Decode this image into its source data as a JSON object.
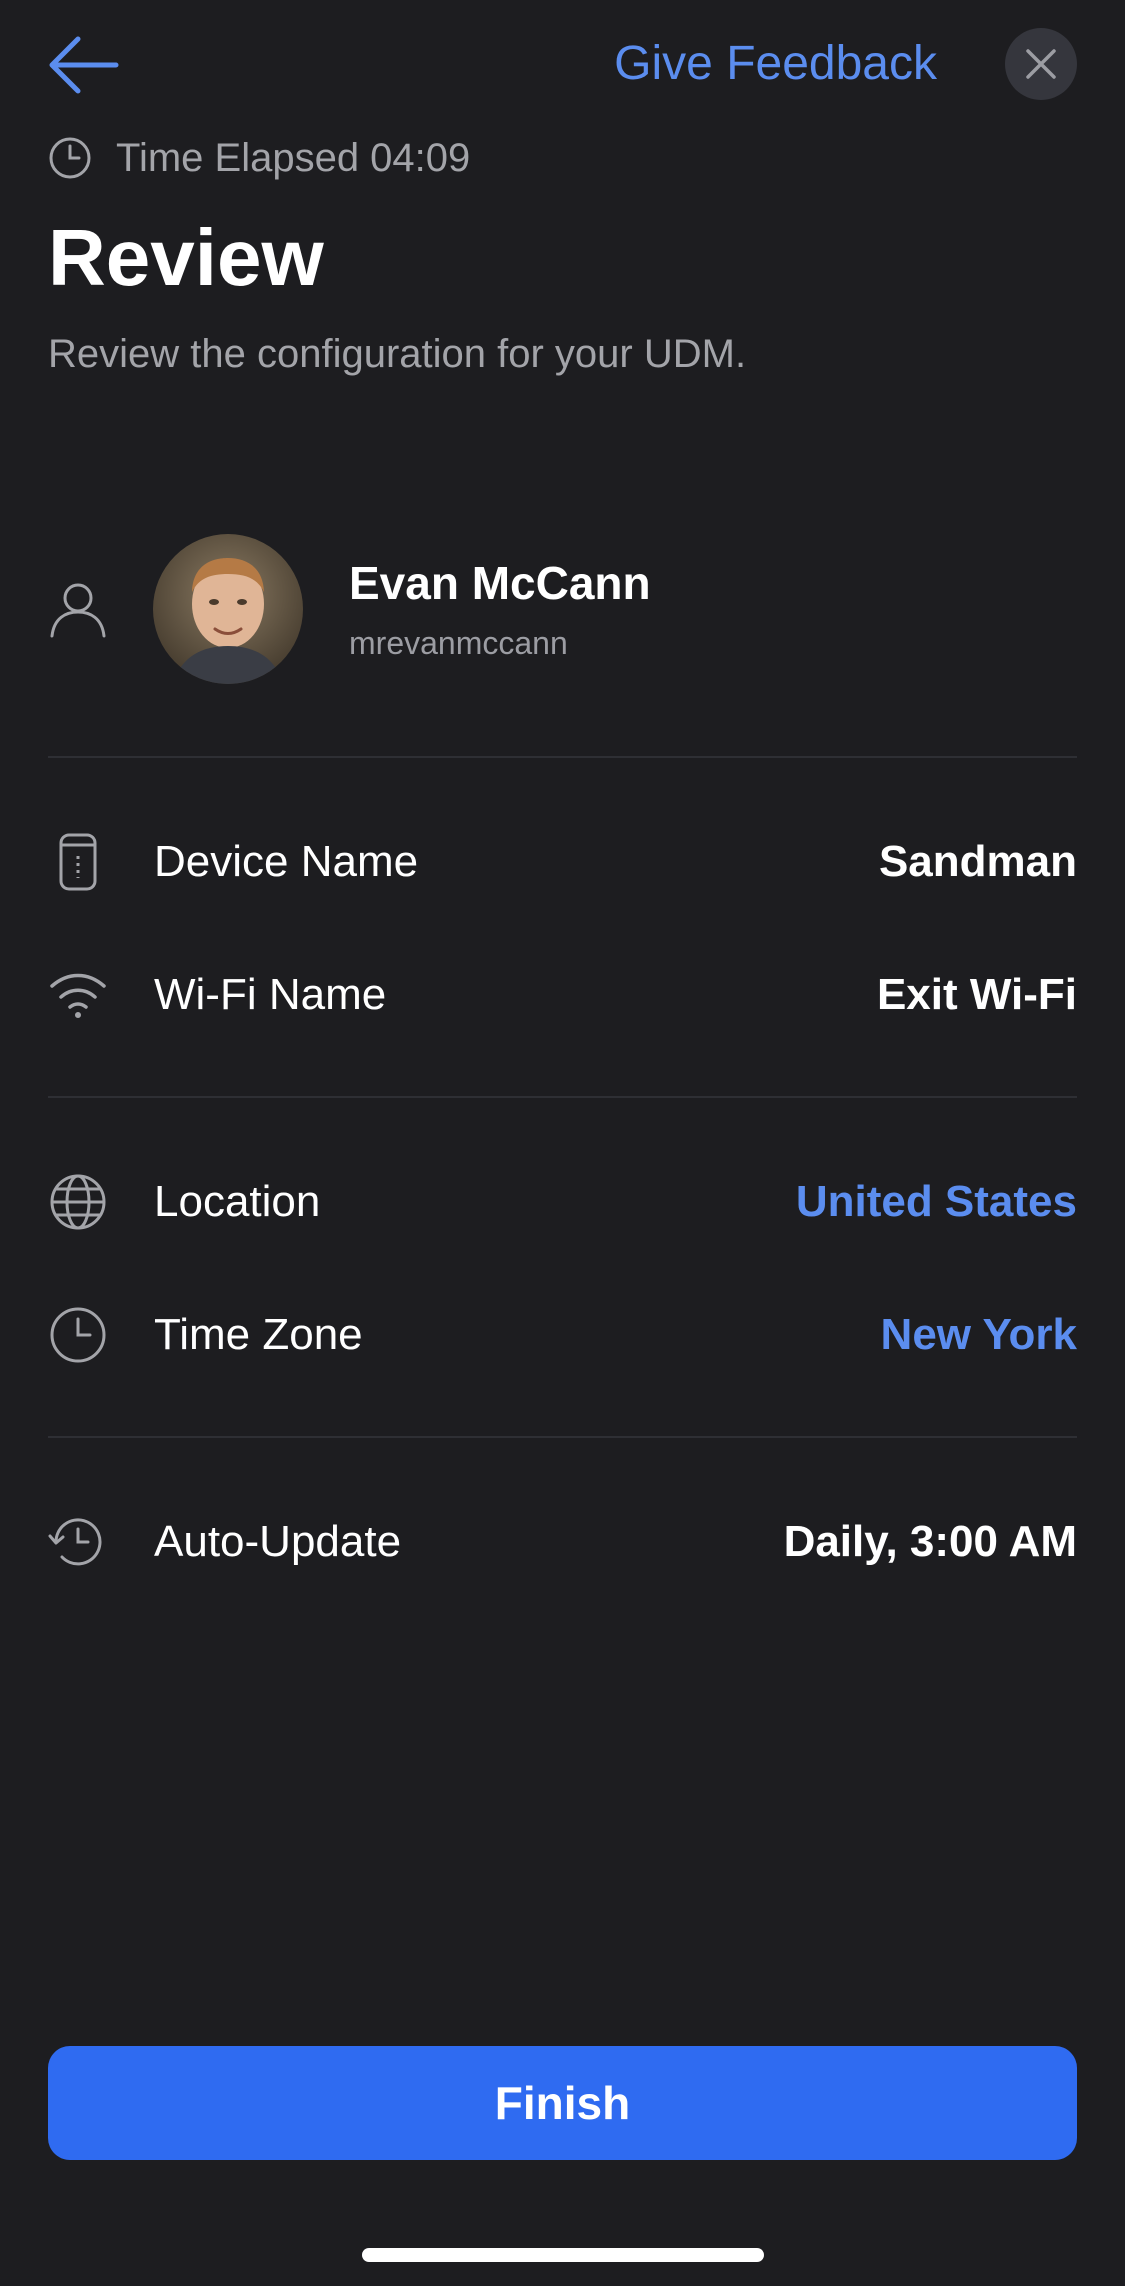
{
  "header": {
    "back_icon": "arrow-left-icon",
    "feedback_label": "Give Feedback",
    "close_icon": "close-icon"
  },
  "elapsed": {
    "icon": "clock-icon",
    "text": "Time Elapsed 04:09"
  },
  "page": {
    "title": "Review",
    "subtitle": "Review the configuration for your UDM."
  },
  "user": {
    "icon": "person-icon",
    "name": "Evan McCann",
    "handle": "mrevanmccann"
  },
  "rows": [
    {
      "icon": "device-icon",
      "label": "Device Name",
      "value": "Sandman"
    },
    {
      "icon": "wifi-icon",
      "label": "Wi-Fi Name",
      "value": "Exit Wi-Fi"
    },
    {
      "icon": "globe-icon",
      "label": "Location",
      "value": "United States"
    },
    {
      "icon": "clock-icon",
      "label": "Time Zone",
      "value": "New York"
    },
    {
      "icon": "auto-update-icon",
      "label": "Auto-Update",
      "value": "Daily, 3:00 AM"
    }
  ],
  "footer": {
    "finish_label": "Finish"
  },
  "colors": {
    "background": "#1d1d20",
    "accent": "#5b8def",
    "button": "#2f6bf1",
    "muted_text": "#a3a4a9"
  }
}
